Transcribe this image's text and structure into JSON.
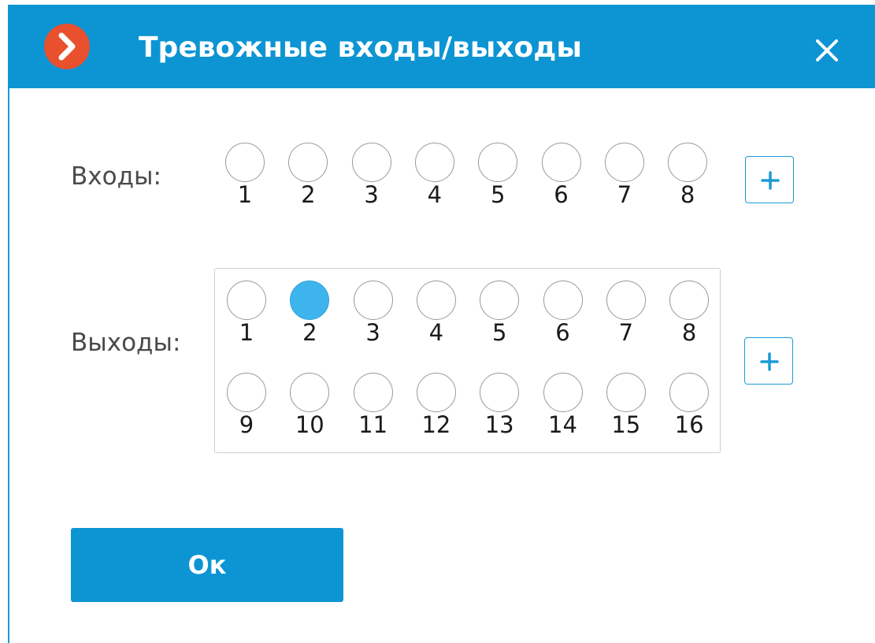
{
  "window": {
    "title": "Тревожные входы/выходы",
    "logo_icon": "app-logo-chevron-icon",
    "close_icon": "close-icon",
    "colors": {
      "titlebar": "#0d95d3",
      "logo": "#e8502e",
      "active_dot": "#3eb4ec"
    }
  },
  "inputs": {
    "label": "Входы:",
    "items": [
      {
        "num": "1",
        "active": false
      },
      {
        "num": "2",
        "active": false
      },
      {
        "num": "3",
        "active": false
      },
      {
        "num": "4",
        "active": false
      },
      {
        "num": "5",
        "active": false
      },
      {
        "num": "6",
        "active": false
      },
      {
        "num": "7",
        "active": false
      },
      {
        "num": "8",
        "active": false
      }
    ],
    "add_icon": "plus-icon"
  },
  "outputs": {
    "label": "Выходы:",
    "items": [
      {
        "num": "1",
        "active": false
      },
      {
        "num": "2",
        "active": true
      },
      {
        "num": "3",
        "active": false
      },
      {
        "num": "4",
        "active": false
      },
      {
        "num": "5",
        "active": false
      },
      {
        "num": "6",
        "active": false
      },
      {
        "num": "7",
        "active": false
      },
      {
        "num": "8",
        "active": false
      },
      {
        "num": "9",
        "active": false
      },
      {
        "num": "10",
        "active": false
      },
      {
        "num": "11",
        "active": false
      },
      {
        "num": "12",
        "active": false
      },
      {
        "num": "13",
        "active": false
      },
      {
        "num": "14",
        "active": false
      },
      {
        "num": "15",
        "active": false
      },
      {
        "num": "16",
        "active": false
      }
    ],
    "add_icon": "plus-icon"
  },
  "footer": {
    "ok_label": "Ок"
  }
}
